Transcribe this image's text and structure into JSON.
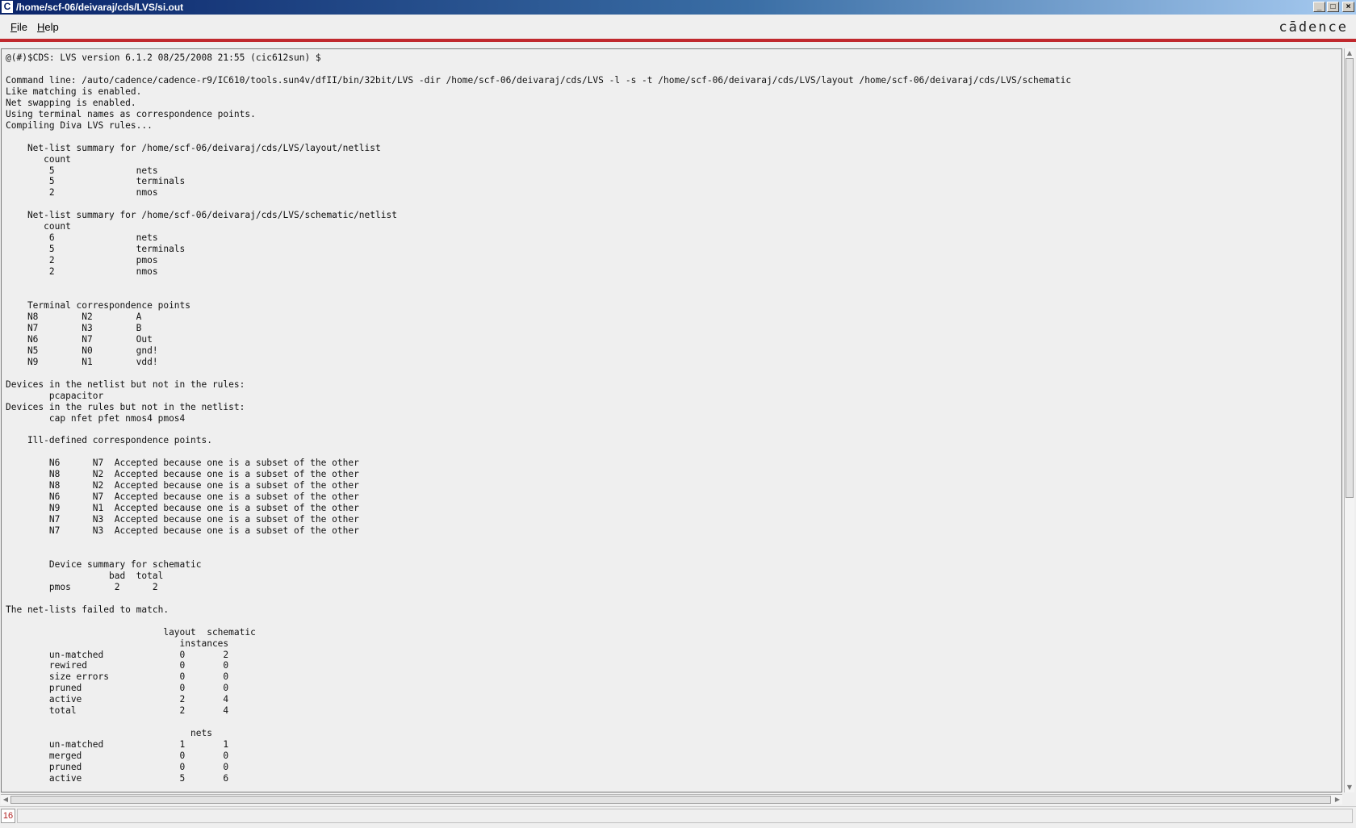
{
  "window": {
    "title": "/home/scf-06/deivaraj/cds/LVS/si.out",
    "icon_glyph": "C",
    "buttons": {
      "minimize": "_",
      "maximize": "□",
      "close": "×"
    }
  },
  "menubar": {
    "file_label_u": "F",
    "file_label_rest": "ile",
    "help_label_u": "H",
    "help_label_rest": "elp",
    "logo": "cādence"
  },
  "log": {
    "lines": [
      "@(#)$CDS: LVS version 6.1.2 08/25/2008 21:55 (cic612sun) $",
      "",
      "Command line: /auto/cadence/cadence-r9/IC610/tools.sun4v/dfII/bin/32bit/LVS -dir /home/scf-06/deivaraj/cds/LVS -l -s -t /home/scf-06/deivaraj/cds/LVS/layout /home/scf-06/deivaraj/cds/LVS/schematic",
      "Like matching is enabled.",
      "Net swapping is enabled.",
      "Using terminal names as correspondence points.",
      "Compiling Diva LVS rules...",
      "",
      "    Net-list summary for /home/scf-06/deivaraj/cds/LVS/layout/netlist",
      "       count",
      "        5               nets",
      "        5               terminals",
      "        2               nmos",
      "",
      "    Net-list summary for /home/scf-06/deivaraj/cds/LVS/schematic/netlist",
      "       count",
      "        6               nets",
      "        5               terminals",
      "        2               pmos",
      "        2               nmos",
      "",
      "",
      "    Terminal correspondence points",
      "    N8        N2        A",
      "    N7        N3        B",
      "    N6        N7        Out",
      "    N5        N0        gnd!",
      "    N9        N1        vdd!",
      "",
      "Devices in the netlist but not in the rules:",
      "        pcapacitor",
      "Devices in the rules but not in the netlist:",
      "        cap nfet pfet nmos4 pmos4",
      "",
      "    Ill-defined correspondence points.",
      "",
      "        N6      N7  Accepted because one is a subset of the other",
      "        N8      N2  Accepted because one is a subset of the other",
      "        N8      N2  Accepted because one is a subset of the other",
      "        N6      N7  Accepted because one is a subset of the other",
      "        N9      N1  Accepted because one is a subset of the other",
      "        N7      N3  Accepted because one is a subset of the other",
      "        N7      N3  Accepted because one is a subset of the other",
      "",
      "",
      "        Device summary for schematic",
      "                   bad  total",
      "        pmos        2      2",
      "",
      "The net-lists failed to match.",
      "",
      "                             layout  schematic",
      "                                instances",
      "        un-matched              0       2",
      "        rewired                 0       0",
      "        size errors             0       0",
      "        pruned                  0       0",
      "        active                  2       4",
      "        total                   2       4",
      "",
      "                                  nets",
      "        un-matched              1       1",
      "        merged                  0       0",
      "        pruned                  0       0",
      "        active                  5       6"
    ]
  },
  "statusbar": {
    "count": "16",
    "message": ""
  }
}
